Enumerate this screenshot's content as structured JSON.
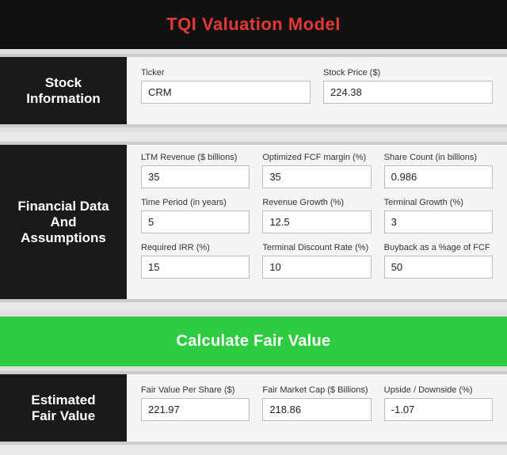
{
  "header": {
    "title": "TQI Valuation Model",
    "title_red": "!"
  },
  "stock_section": {
    "label": "Stock\nInformation",
    "ticker_label": "Ticker",
    "ticker_value": "CRM",
    "price_label": "Stock Price ($)",
    "price_value": "224.38"
  },
  "financial_section": {
    "label": "Financial Data\nAnd\nAssumptions",
    "row1": [
      {
        "label": "LTM Revenue ($ billions)",
        "value": "35"
      },
      {
        "label": "Optimized FCF margin (%)",
        "value": "35"
      },
      {
        "label": "Share Count (in billions)",
        "value": "0.986"
      }
    ],
    "row2": [
      {
        "label": "Time Period (in years)",
        "value": "5"
      },
      {
        "label": "Revenue Growth (%)",
        "value": "12.5"
      },
      {
        "label": "Terminal Growth (%)",
        "value": "3"
      }
    ],
    "row3": [
      {
        "label": "Required IRR (%)",
        "value": "15"
      },
      {
        "label": "Terminal Discount Rate (%)",
        "value": "10"
      },
      {
        "label": "Buyback as a %age of FCF",
        "value": "50"
      }
    ]
  },
  "calculate_btn_label": "Calculate Fair Value",
  "fair_value_section": {
    "label": "Estimated\nFair Value",
    "row": [
      {
        "label": "Fair Value Per Share ($)",
        "value": "221.97"
      },
      {
        "label": "Fair Market Cap ($ Billions)",
        "value": "218.86"
      },
      {
        "label": "Upside / Downside (%)",
        "value": "-1.07"
      }
    ]
  }
}
